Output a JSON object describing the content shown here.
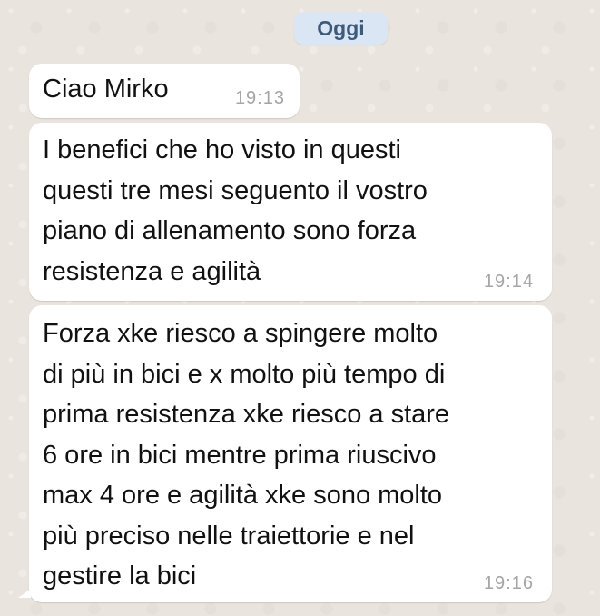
{
  "chat": {
    "date_label": "Oggi",
    "messages": [
      {
        "text": "Ciao Mirko",
        "time": "19:13"
      },
      {
        "text": "I benefici che ho visto in questi\nquesti tre mesi seguento il vostro\npiano di allenamento sono forza\nresistenza e agilità",
        "time": "19:14"
      },
      {
        "text": "Forza xke riesco a spingere molto\ndi più in bici e x molto più tempo di\nprima resistenza xke riesco a stare\n6 ore in bici mentre prima riuscivo\nmax 4 ore e agilità xke sono molto\npiù preciso nelle traiettorie e nel\ngestire la bici",
        "time": "19:16"
      }
    ]
  }
}
